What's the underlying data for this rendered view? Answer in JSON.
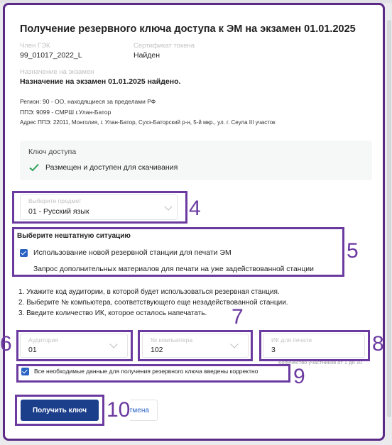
{
  "dialog": {
    "title": "Получение резервного ключа доступа к ЭМ на экзамен 01.01.2025",
    "member_label": "Член ГЭК",
    "member_value": "99_01017_2022_L",
    "cert_label": "Сертификат токена",
    "cert_value": "Найден",
    "purpose_label": "Назначение на экзамен",
    "purpose_value": "Назначение на экзамен 01.01.2025 найдено.",
    "region": "Регион: 90 - ОО, находящиеся за пределами РФ",
    "ppe": "ППЭ: 9099 - СМРШ г.Улан-Батор",
    "address": "Адрес ППЭ: 22011, Монголия, г. Улан-Батор, Сухэ-Баторский р-н, 5-й мкр., ул. г. Сеула III участок"
  },
  "access_key": {
    "label": "Ключ доступа",
    "status": "Размещен и доступен для скачивания",
    "status_color": "#2e9e57"
  },
  "subject": {
    "label": "Выберите предмет",
    "value": "01 - Русский язык"
  },
  "emergency": {
    "heading": "Выберите нештатную ситуацию",
    "options": [
      {
        "label": "Использование новой резервной станции для печати ЭМ",
        "checked": true
      },
      {
        "label": "Запрос дополнительных материалов для печати на уже задействованной станции",
        "checked": false
      }
    ]
  },
  "instructions": [
    "1. Укажите код аудитории, в которой будет использоваться резервная станция.",
    "2. Выберите № компьютера, соответствующего еще незадействованной станции.",
    "3. Введите количество ИК, которое осталось напечатать."
  ],
  "auditorium": {
    "label": "Аудитория",
    "value": "01"
  },
  "computer": {
    "label": "№ компьютера",
    "value": "102"
  },
  "ik": {
    "label": "ИК для печати",
    "value": "3",
    "hint": "Количество участников от 1 до 10"
  },
  "confirm": {
    "label": "Все необходимые данные для получения резервного ключа введены корректно",
    "checked": true
  },
  "buttons": {
    "get_key": "Получить ключ",
    "cancel": "Отмена"
  },
  "annotations": [
    "4",
    "5",
    "6",
    "7",
    "8",
    "9",
    "10"
  ],
  "accent_color": "#6b3aa0",
  "primary_color": "#1c3f8c"
}
